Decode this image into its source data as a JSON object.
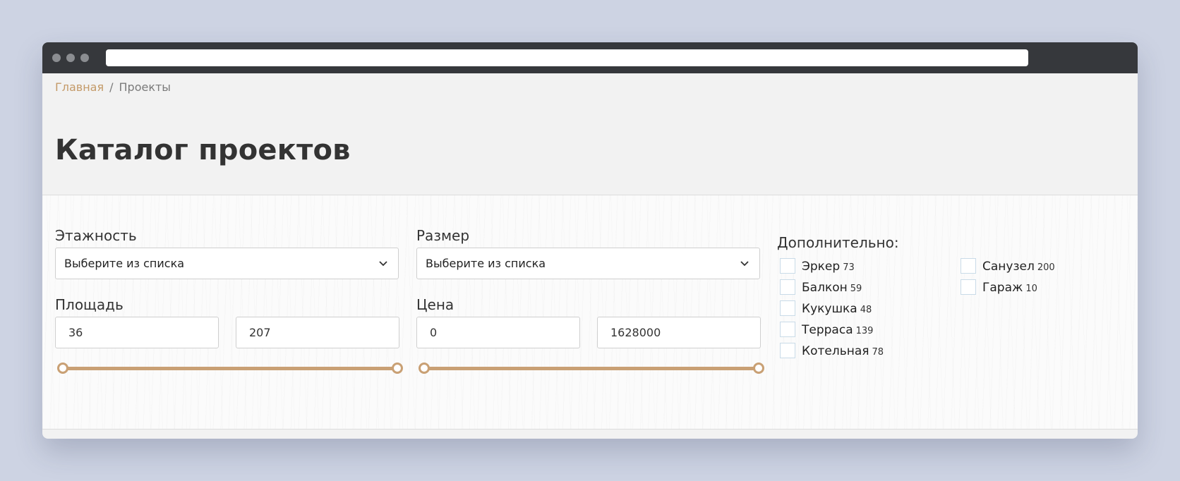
{
  "breadcrumb": {
    "home": "Главная",
    "separator": "/",
    "current": "Проекты"
  },
  "page_title": "Каталог проектов",
  "filters": {
    "floors": {
      "label": "Этажность",
      "selected": "Выберите из списка"
    },
    "size": {
      "label": "Размер",
      "selected": "Выберите из списка"
    },
    "area": {
      "label": "Площадь",
      "min": "36",
      "max": "207"
    },
    "price": {
      "label": "Цена",
      "min": "0",
      "max": "1628000"
    },
    "extra": {
      "title": "Дополнительно:",
      "options": [
        {
          "label": "Эркер",
          "count": "73"
        },
        {
          "label": "Балкон",
          "count": "59"
        },
        {
          "label": "Кукушка",
          "count": "48"
        },
        {
          "label": "Терраса",
          "count": "139"
        },
        {
          "label": "Котельная",
          "count": "78"
        },
        {
          "label": "Санузел",
          "count": "200"
        },
        {
          "label": "Гараж",
          "count": "10"
        }
      ]
    }
  },
  "colors": {
    "accent": "#c49a68",
    "slider": "#c9a074",
    "background": "#cdd3e3",
    "titlebar": "#36383c"
  }
}
